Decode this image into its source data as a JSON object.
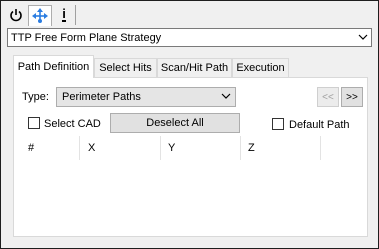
{
  "toolbar": {
    "buttons": [
      {
        "icon": "power-icon",
        "active": false
      },
      {
        "icon": "move-axes-icon",
        "active": true
      },
      {
        "icon": "info-icon",
        "active": false
      }
    ],
    "info_glyph": "i"
  },
  "strategy": {
    "selected": "TTP Free Form Plane Strategy"
  },
  "tabs": [
    {
      "label": "Path Definition",
      "active": true
    },
    {
      "label": "Select Hits",
      "active": false
    },
    {
      "label": "Scan/Hit Path",
      "active": false
    },
    {
      "label": "Execution",
      "active": false
    }
  ],
  "panel": {
    "type_label": "Type:",
    "type_value": "Perimeter Paths",
    "prev_label": "<<",
    "next_label": ">>",
    "select_cad_label": "Select CAD",
    "deselect_all_label": "Deselect All",
    "default_path_label": "Default Path",
    "columns": [
      "#",
      "X",
      "Y",
      "Z"
    ]
  },
  "colors": {
    "accent_icon": "#2b7de1",
    "frame": "#1e1e1e"
  }
}
